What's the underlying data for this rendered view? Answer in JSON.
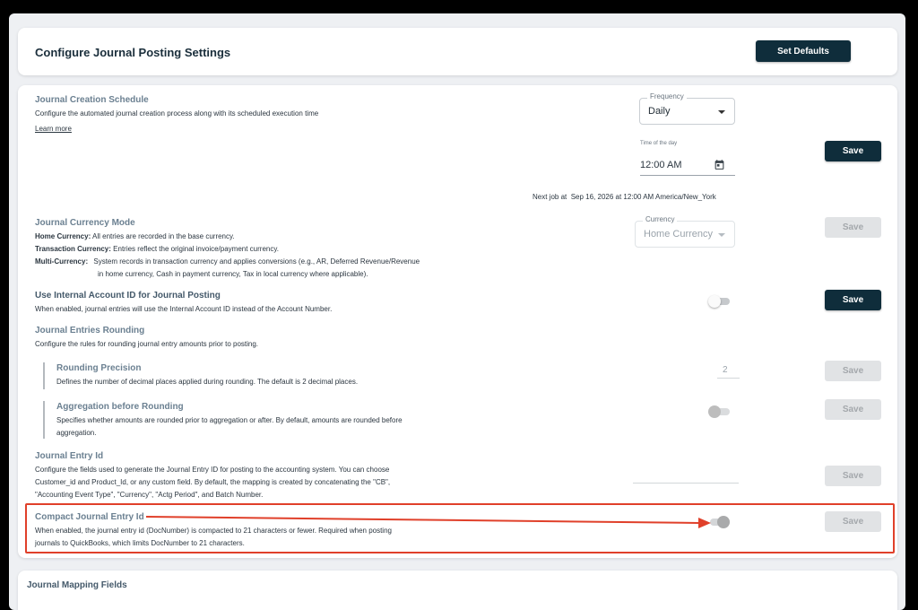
{
  "header": {
    "title": "Configure Journal Posting Settings",
    "set_defaults_label": "Set Defaults"
  },
  "schedule": {
    "title": "Journal Creation Schedule",
    "desc": "Configure the automated journal creation process along with its scheduled execution time",
    "learn_more": "Learn more",
    "frequency_label": "Frequency",
    "frequency_value": "Daily",
    "time_label": "Time of the day",
    "time_value": "12:00 AM",
    "next_job_prefix": "Next job at",
    "next_job_value": "Sep 16, 2026 at 12:00 AM America/New_York",
    "save_label": "Save"
  },
  "currency": {
    "title": "Journal Currency Mode",
    "home_term": "Home Currency:",
    "home_desc": "All entries are recorded in the base currency.",
    "transaction_term": "Transaction Currency:",
    "transaction_desc": "Entries reflect the original invoice/payment currency.",
    "multi_term": "Multi-Currency:",
    "multi_desc_1": "System records in transaction currency and applies conversions (e.g., AR, Deferred Revenue/Revenue",
    "multi_desc_2": "in home currency, Cash in payment currency, Tax in local currency where applicable).",
    "select_label": "Currency",
    "select_value": "Home Currency",
    "save_label": "Save"
  },
  "internal_id": {
    "title": "Use Internal Account ID for Journal Posting",
    "desc": "When enabled, journal entries will use the Internal Account ID instead of the Account Number.",
    "enabled": false,
    "save_label": "Save"
  },
  "rounding": {
    "title": "Journal Entries Rounding",
    "desc": "Configure the rules for rounding journal entry amounts prior to posting.",
    "precision_title": "Rounding Precision",
    "precision_desc": "Defines the number of decimal places applied during rounding. The default is 2 decimal places.",
    "precision_value": "2",
    "precision_save": "Save",
    "aggregation_title": "Aggregation before Rounding",
    "aggregation_desc_1": "Specifies whether amounts are rounded prior to aggregation or after. By default, amounts are rounded before",
    "aggregation_desc_2": "aggregation.",
    "aggregation_enabled": false,
    "aggregation_save": "Save"
  },
  "entry_id": {
    "title": "Journal Entry Id",
    "desc_1": "Configure the fields used to generate the Journal Entry ID for posting to the accounting system. You can choose",
    "desc_2": "Customer_id and Product_Id, or any custom field. By default, the mapping is created by concatenating the \"CB\",",
    "desc_3": "\"Accounting Event Type\", \"Currency\", \"Actg Period\", and Batch Number.",
    "save_label": "Save"
  },
  "compact_id": {
    "title": "Compact Journal Entry Id",
    "desc_1": "When enabled, the journal entry id (DocNumber) is compacted to 21 characters or fewer. Required when posting",
    "desc_2": "journals to QuickBooks, which limits DocNumber to 21 characters.",
    "enabled": true,
    "save_label": "Save"
  },
  "mapping": {
    "title": "Journal Mapping Fields"
  },
  "colors": {
    "primary": "#0f2d3b",
    "annotation": "#e0402a",
    "disabled_button": "#e1e3e5"
  }
}
